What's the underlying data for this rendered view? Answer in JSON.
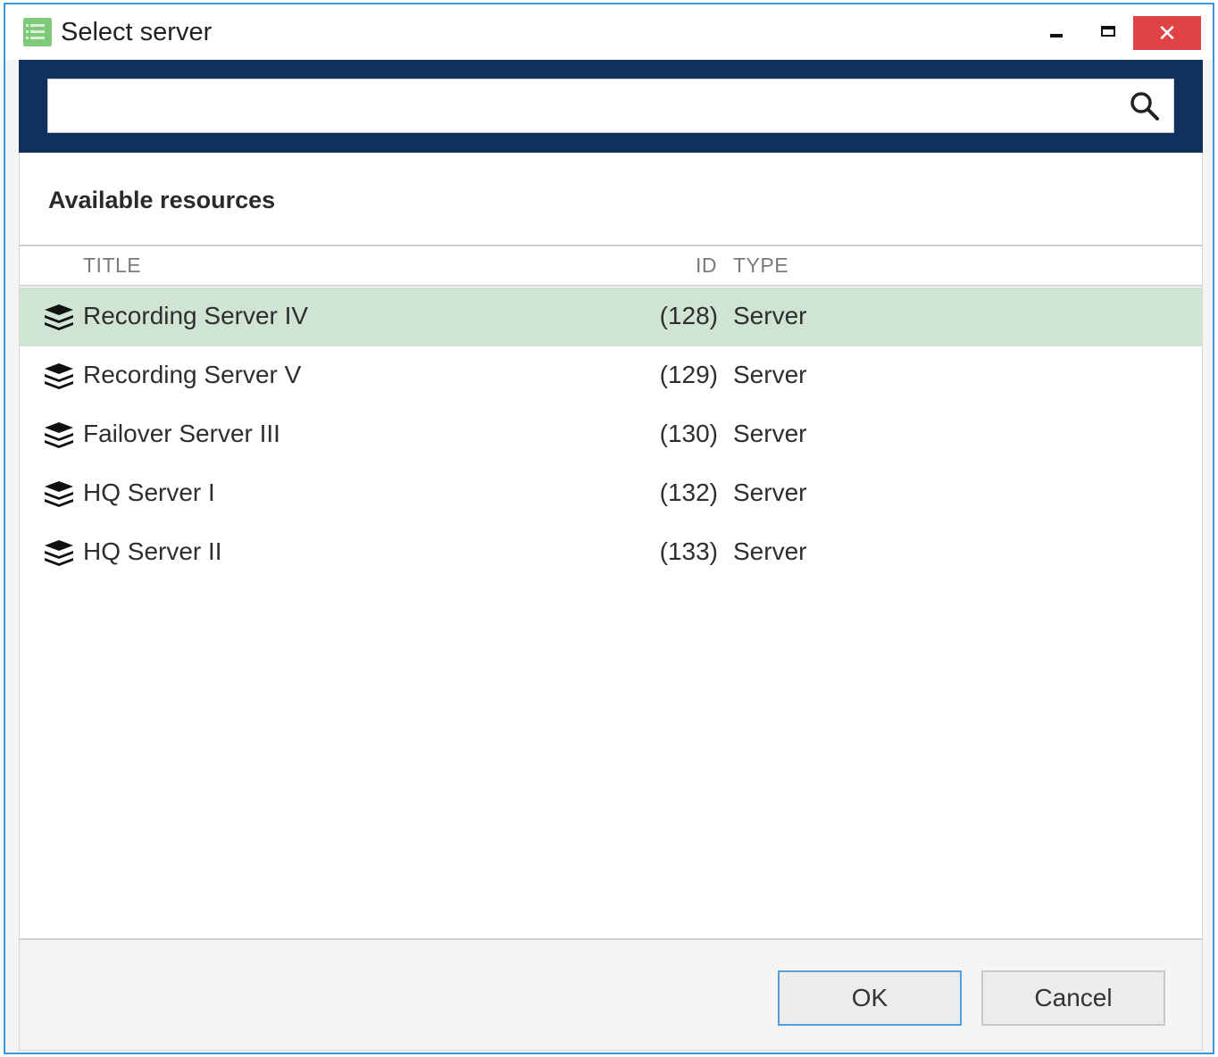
{
  "window": {
    "title": "Select server",
    "close_glyph": "✕"
  },
  "search": {
    "value": "",
    "placeholder": ""
  },
  "section": {
    "title": "Available resources"
  },
  "table": {
    "columns": {
      "title": "TITLE",
      "id": "ID",
      "type": "TYPE"
    },
    "rows": [
      {
        "title": "Recording Server IV",
        "id": "(128)",
        "type": "Server",
        "selected": true
      },
      {
        "title": "Recording Server V",
        "id": "(129)",
        "type": "Server",
        "selected": false
      },
      {
        "title": "Failover Server III",
        "id": "(130)",
        "type": "Server",
        "selected": false
      },
      {
        "title": "HQ Server I",
        "id": "(132)",
        "type": "Server",
        "selected": false
      },
      {
        "title": "HQ Server II",
        "id": "(133)",
        "type": "Server",
        "selected": false
      }
    ]
  },
  "footer": {
    "ok_label": "OK",
    "cancel_label": "Cancel"
  },
  "colors": {
    "header_band": "#12305d",
    "selected_row": "#cfe4d3",
    "close_button": "#e04343",
    "ok_border": "#4fa3e4"
  },
  "icons": {
    "app": "app-list-icon",
    "search": "search-icon",
    "server": "server-stack-icon"
  }
}
